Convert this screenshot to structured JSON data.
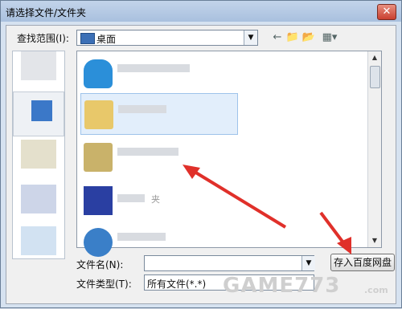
{
  "window": {
    "title": "请选择文件/文件夹",
    "close_glyph": "✕"
  },
  "toolbar": {
    "lookin_label": "查找范围(I):",
    "lookin_value": "桌面",
    "back_icon": "←",
    "up_icon": "📁",
    "newfolder_icon": "📂",
    "view_icon": "▦▾"
  },
  "file_list": {
    "items": [
      {
        "icon": "blue-cloud-icon",
        "color": "#2b8fd9"
      },
      {
        "icon": "folder-icon",
        "color": "#e8c86a",
        "selected": true
      },
      {
        "icon": "folder-icon",
        "color": "#c9b26a"
      },
      {
        "icon": "app-icon",
        "color": "#2a3fa2",
        "label_suffix": "夹"
      },
      {
        "icon": "app-icon",
        "color": "#3a7fc8"
      }
    ]
  },
  "form": {
    "filename_label": "文件名(N):",
    "filename_value": "",
    "filetype_label": "文件类型(T):",
    "filetype_value": "所有文件(*.*)",
    "save_button": "存入百度网盘"
  },
  "watermark": {
    "text": "GAME773",
    "sub": ".com"
  },
  "colors": {
    "accent": "#3b6fb6",
    "arrow": "#e0302a"
  }
}
